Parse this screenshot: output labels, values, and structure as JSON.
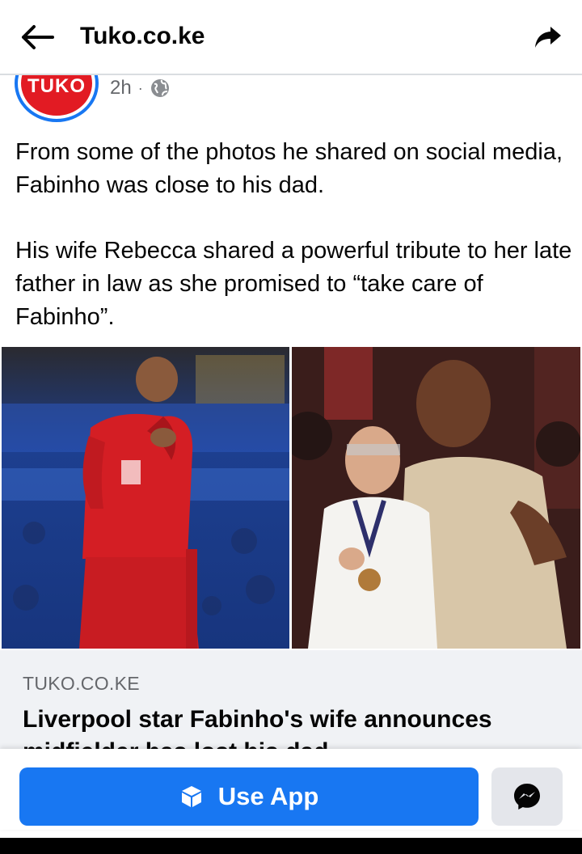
{
  "topbar": {
    "title": "Tuko.co.ke",
    "back_icon": "arrow-left-icon",
    "share_icon": "share-arrow-icon"
  },
  "post": {
    "page_logo_text": "TUKO",
    "time": "2h",
    "separator": "·",
    "privacy_icon": "globe-icon",
    "paragraphs": [
      "From some of the photos he shared on social media, Fabinho was close to his dad.",
      "His wife Rebecca shared a powerful tribute to her late father in law as she promised to “take care of Fabinho”."
    ]
  },
  "link_card": {
    "domain": "TUKO.CO.KE",
    "title": "Liverpool star Fabinho's wife announces midfielder has lost his dad"
  },
  "bottom": {
    "use_app_label": "Use App",
    "use_app_icon": "cube-icon",
    "messenger_icon": "messenger-icon"
  },
  "colors": {
    "brand_blue": "#1877f2",
    "logo_red": "#e21b23",
    "muted_text": "#65676b",
    "card_bg": "#f0f2f5"
  }
}
